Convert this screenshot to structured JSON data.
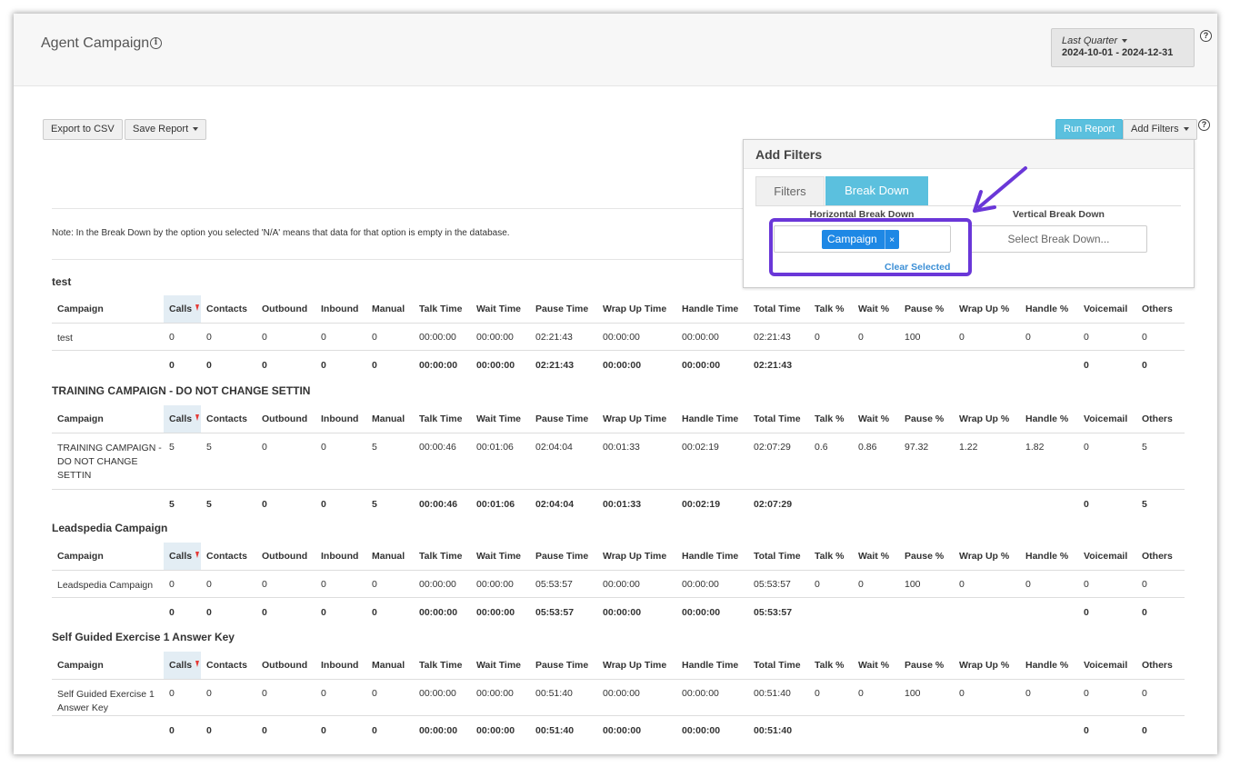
{
  "header": {
    "title": "Agent Campaign",
    "info_icon": "i",
    "date_label": "Last Quarter",
    "date_range": "2024-10-01 - 2024-12-31",
    "help_icon": "?"
  },
  "toolbar": {
    "export_label": "Export to CSV",
    "save_report_label": "Save Report",
    "run_report_label": "Run Report",
    "add_filters_label": "Add Filters",
    "help_icon": "?"
  },
  "note": "Note: In the Break Down by the option you selected 'N/A' means that data for that option is empty in the database.",
  "filters_panel": {
    "title": "Add Filters",
    "tabs": [
      "Filters",
      "Break Down"
    ],
    "active_tab": "Break Down",
    "horizontal_label": "Horizontal Break Down",
    "horizontal_chip": "Campaign",
    "chip_remove": "×",
    "vertical_label": "Vertical Break Down",
    "vertical_placeholder": "Select Break Down...",
    "clear_label": "Clear Selected"
  },
  "columns": [
    "Campaign",
    "Calls",
    "Contacts",
    "Outbound",
    "Inbound",
    "Manual",
    "Talk Time",
    "Wait Time",
    "Pause Time",
    "Wrap Up Time",
    "Handle Time",
    "Total Time",
    "Talk %",
    "Wait %",
    "Pause %",
    "Wrap Up %",
    "Handle %",
    "Voicemail",
    "Others"
  ],
  "sections": [
    {
      "title": "test",
      "row": [
        "test",
        "0",
        "0",
        "0",
        "0",
        "0",
        "00:00:00",
        "00:00:00",
        "02:21:43",
        "00:00:00",
        "00:00:00",
        "02:21:43",
        "0",
        "0",
        "100",
        "0",
        "0",
        "0",
        "0"
      ],
      "total": [
        "",
        "0",
        "0",
        "0",
        "0",
        "0",
        "00:00:00",
        "00:00:00",
        "02:21:43",
        "00:00:00",
        "00:00:00",
        "02:21:43",
        "",
        "",
        "",
        "",
        "",
        "0",
        "0"
      ]
    },
    {
      "title": "TRAINING CAMPAIGN - DO NOT CHANGE SETTIN",
      "row": [
        "TRAINING CAMPAIGN - DO NOT CHANGE SETTIN",
        "5",
        "5",
        "0",
        "0",
        "5",
        "00:00:46",
        "00:01:06",
        "02:04:04",
        "00:01:33",
        "00:02:19",
        "02:07:29",
        "0.6",
        "0.86",
        "97.32",
        "1.22",
        "1.82",
        "0",
        "5"
      ],
      "total": [
        "",
        "5",
        "5",
        "0",
        "0",
        "5",
        "00:00:46",
        "00:01:06",
        "02:04:04",
        "00:01:33",
        "00:02:19",
        "02:07:29",
        "",
        "",
        "",
        "",
        "",
        "0",
        "5"
      ]
    },
    {
      "title": "Leadspedia Campaign",
      "row": [
        "Leadspedia Campaign",
        "0",
        "0",
        "0",
        "0",
        "0",
        "00:00:00",
        "00:00:00",
        "05:53:57",
        "00:00:00",
        "00:00:00",
        "05:53:57",
        "0",
        "0",
        "100",
        "0",
        "0",
        "0",
        "0"
      ],
      "total": [
        "",
        "0",
        "0",
        "0",
        "0",
        "0",
        "00:00:00",
        "00:00:00",
        "05:53:57",
        "00:00:00",
        "00:00:00",
        "05:53:57",
        "",
        "",
        "",
        "",
        "",
        "0",
        "0"
      ]
    },
    {
      "title": "Self Guided Exercise 1 Answer Key",
      "row": [
        "Self Guided Exercise 1 Answer Key",
        "0",
        "0",
        "0",
        "0",
        "0",
        "00:00:00",
        "00:00:00",
        "00:51:40",
        "00:00:00",
        "00:00:00",
        "00:51:40",
        "0",
        "0",
        "100",
        "0",
        "0",
        "0",
        "0"
      ],
      "total": [
        "",
        "0",
        "0",
        "0",
        "0",
        "0",
        "00:00:00",
        "00:00:00",
        "00:51:40",
        "00:00:00",
        "00:00:00",
        "00:51:40",
        "",
        "",
        "",
        "",
        "",
        "0",
        "0"
      ]
    }
  ],
  "colors": {
    "primary_button": "#5bc0de",
    "chip": "#1e88e5",
    "highlight": "#6a37d8",
    "sort_indicator": "#e53935"
  }
}
